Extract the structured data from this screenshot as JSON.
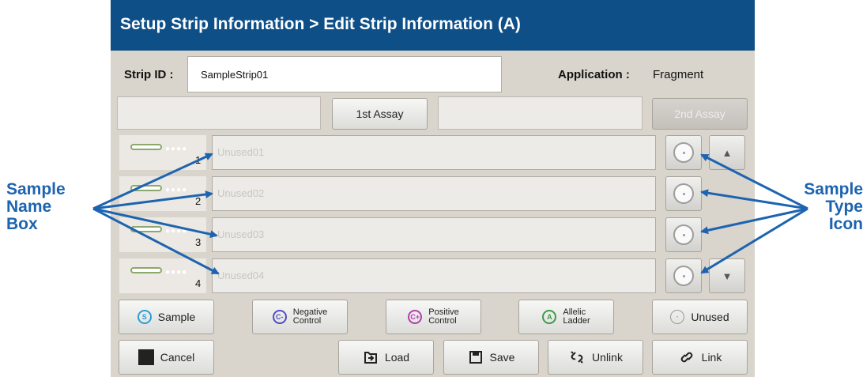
{
  "title": "Setup Strip Information > Edit Strip Information (A)",
  "strip_id": {
    "label": "Strip ID :",
    "value": "SampleStrip01"
  },
  "application": {
    "label": "Application :",
    "value": "Fragment"
  },
  "assay": {
    "first_label": "1st Assay",
    "second_label": "2nd Assay",
    "second_enabled": false
  },
  "rows": [
    {
      "number": "1",
      "name": "Unused01"
    },
    {
      "number": "2",
      "name": "Unused02"
    },
    {
      "number": "3",
      "name": "Unused03"
    },
    {
      "number": "4",
      "name": "Unused04"
    }
  ],
  "type_buttons": [
    {
      "label": "Sample",
      "icon": "sample-icon",
      "glyph": "S"
    },
    {
      "label": "Negative Control",
      "line1": "Negative",
      "line2": "Control",
      "icon": "negative-control-icon",
      "glyph": "C-"
    },
    {
      "label": "Positive Control",
      "line1": "Positive",
      "line2": "Control",
      "icon": "positive-control-icon",
      "glyph": "C+"
    },
    {
      "label": "Allelic Ladder",
      "line1": "Allelic",
      "line2": "Ladder",
      "icon": "allelic-ladder-icon",
      "glyph": "A"
    },
    {
      "label": "Unused",
      "icon": "unused-icon",
      "glyph": "·"
    }
  ],
  "actions": {
    "cancel": "Cancel",
    "load": "Load",
    "save": "Save",
    "unlink": "Unlink",
    "link": "Link"
  },
  "annotations": {
    "left": {
      "line1": "Sample",
      "line2": "Name",
      "line3": "Box"
    },
    "right": {
      "line1": "Sample",
      "line2": "Type",
      "line3": "Icon"
    }
  },
  "colors": {
    "title_bar": "#0f4f87",
    "annotation": "#1d64b0",
    "sample": "#2a9fd6",
    "negative": "#4f4cc4",
    "positive": "#b23fae",
    "allelic": "#3c9b48"
  }
}
